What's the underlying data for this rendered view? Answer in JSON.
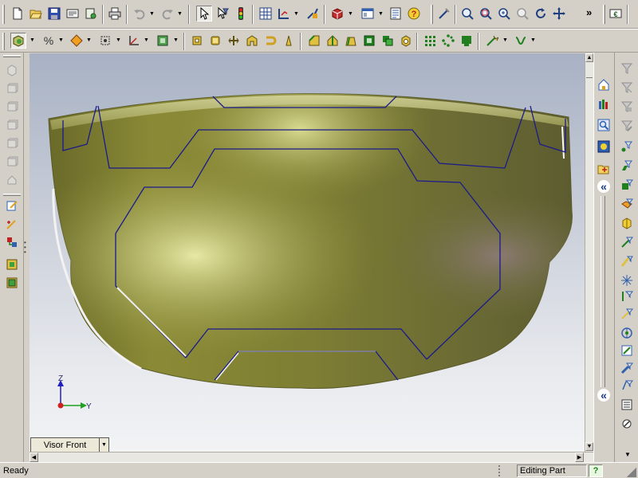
{
  "toolbar_main": {
    "buttons": [
      "new-document",
      "open-file",
      "save",
      "print-preview",
      "options",
      "print",
      "undo",
      "redo",
      "select",
      "select-filter",
      "rebuild-traffic-light",
      "grid",
      "dimension",
      "smart-mate",
      "3d-box",
      "window-arrange",
      "properties",
      "help",
      "sketch-tools",
      "zoom-to-fit",
      "zoom-to-area",
      "zoom-in-out",
      "zoom-to-selection",
      "rotate-view",
      "pan"
    ],
    "overflow": "»"
  },
  "toolbar_sketch": {
    "buttons": [
      "view-orientation",
      "display-percent",
      "display-mode",
      "hidden-lines",
      "coordinate",
      "section-view",
      "extrude",
      "revolve",
      "sweep",
      "loft",
      "shell",
      "fillet",
      "chamfer",
      "rib",
      "draft",
      "shell-hollow",
      "pattern",
      "mirror",
      "wrap",
      "curve",
      "spline"
    ]
  },
  "left_toolbar": {
    "buttons": [
      "box-1",
      "box-2",
      "box-3",
      "box-4",
      "box-5",
      "box-6",
      "box-7",
      "sketch-pen",
      "smart-dimension",
      "relations",
      "reference-geometry",
      "component"
    ]
  },
  "task_pane": {
    "buttons": [
      "home",
      "design-library",
      "search",
      "appearances",
      "file-explorer",
      "collapse"
    ],
    "collapse_glyph": "«"
  },
  "right_toolbar": {
    "buttons": [
      "filter-1",
      "filter-2",
      "filter-3",
      "filter-4",
      "point",
      "plane",
      "face-filter",
      "cube",
      "vertex",
      "edge",
      "curve-point",
      "axis",
      "temp-axis",
      "measure",
      "reference-plane",
      "coordinate-system",
      "silhouette",
      "section",
      "collapse",
      "tree",
      "reload"
    ]
  },
  "model": {
    "name": "Visor Front",
    "body_color": "#8f8f3a",
    "highlight_color": "#e6e8a4",
    "edge_color": "#1a1a8c"
  },
  "triad": {
    "z_label": "Z",
    "y_label": "Y",
    "origin_color": "#d02020",
    "axis_color": "#2020c0"
  },
  "view_tab": {
    "label": "Visor Front",
    "arrow": "▼"
  },
  "status": {
    "text": "Ready",
    "mode": "Editing Part",
    "help": "?"
  }
}
